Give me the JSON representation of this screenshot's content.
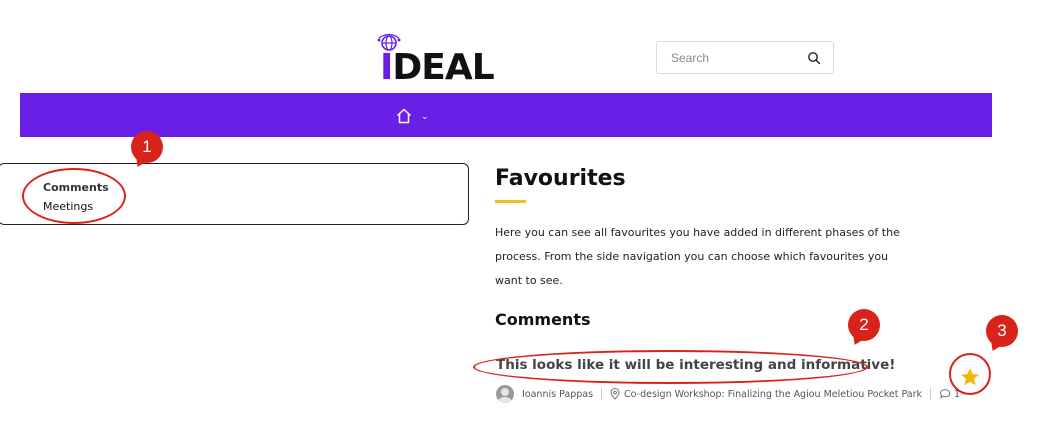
{
  "header": {
    "logo_text_accent": "I",
    "logo_text_rest": "DEAL",
    "search_placeholder": "Search"
  },
  "nav": {
    "home_icon": "home-icon",
    "chevron": "⌄"
  },
  "sidebar": {
    "items": [
      {
        "label": "Comments",
        "active": true
      },
      {
        "label": "Meetings",
        "active": false
      }
    ]
  },
  "main": {
    "title": "Favourites",
    "intro": "Here you can see all favourites you have added in different phases of the process. From the side navigation you can choose which favourites you want to see.",
    "section_title": "Comments",
    "comment": {
      "text": "This looks like it will be interesting and informative!",
      "author": "Ioannis Pappas",
      "location": "Co-design Workshop: Finalizing the Agiou Meletiou Pocket Park",
      "replies": "1",
      "favourited": true
    }
  },
  "annotations": [
    {
      "number": "1"
    },
    {
      "number": "2"
    },
    {
      "number": "3"
    }
  ],
  "colors": {
    "brand": "#6a1fe6",
    "accent": "#f2c318",
    "annotation": "#d8231b"
  }
}
